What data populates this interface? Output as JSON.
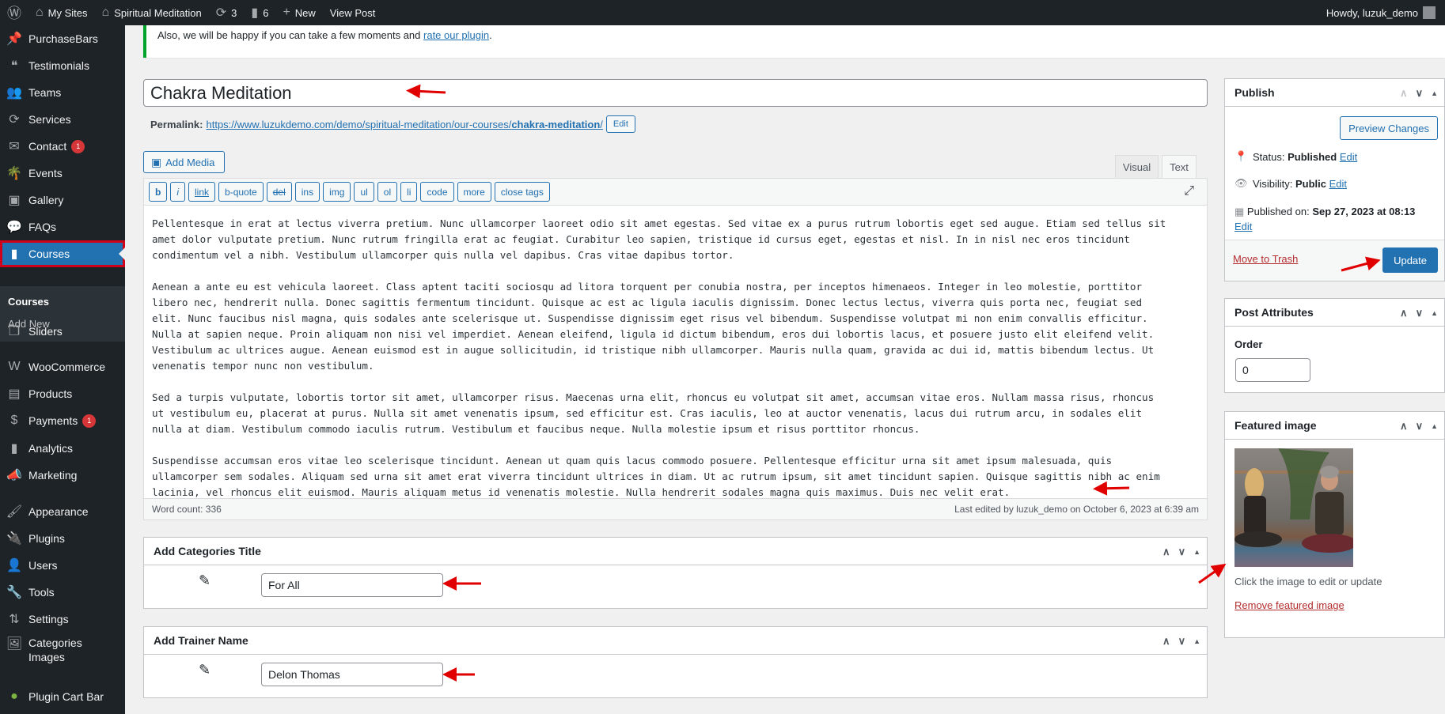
{
  "topbar": {
    "items": [
      {
        "icon": "wordpress-logo-icon",
        "label": ""
      },
      {
        "icon": "my-sites-icon",
        "label": "My Sites"
      },
      {
        "icon": "home-icon",
        "label": "Spiritual Meditation"
      },
      {
        "icon": "updates-icon",
        "label": "3"
      },
      {
        "icon": "comments-icon",
        "label": "6"
      },
      {
        "icon": "plus-icon",
        "label": "New"
      },
      {
        "icon": "",
        "label": "View Post"
      }
    ],
    "howdy": "Howdy, luzuk_demo"
  },
  "sidebar": {
    "items": [
      {
        "label": "PurchaseBars",
        "icon": "pin-icon",
        "glyph": "📌"
      },
      {
        "label": "Testimonials",
        "icon": "testimonial-icon",
        "glyph": "❝"
      },
      {
        "label": "Teams",
        "icon": "groups-icon",
        "glyph": "👥"
      },
      {
        "label": "Services",
        "icon": "update-icon",
        "glyph": "⟳"
      },
      {
        "label": "Contact",
        "icon": "email-icon",
        "glyph": "✉",
        "badge": "1"
      },
      {
        "label": "Events",
        "icon": "palm-tree-icon",
        "glyph": "🌴"
      },
      {
        "label": "Gallery",
        "icon": "media-icon",
        "glyph": "▣"
      },
      {
        "label": "FAQs",
        "icon": "chat-bubble-icon",
        "glyph": "💬"
      },
      {
        "label": "Courses",
        "icon": "book-icon",
        "glyph": "▮",
        "active": true
      },
      {
        "label": "Sliders",
        "icon": "slides-icon",
        "glyph": "❐"
      },
      {
        "label": "WooCommerce",
        "icon": "woocommerce-icon",
        "glyph": "W"
      },
      {
        "label": "Products",
        "icon": "archive-icon",
        "glyph": "▤"
      },
      {
        "label": "Payments",
        "icon": "dollar-icon",
        "glyph": "$",
        "badge": "1"
      },
      {
        "label": "Analytics",
        "icon": "bar-chart-icon",
        "glyph": "▮"
      },
      {
        "label": "Marketing",
        "icon": "megaphone-icon",
        "glyph": "📣"
      },
      {
        "label": "Appearance",
        "icon": "paintbrush-icon",
        "glyph": "🖌"
      },
      {
        "label": "Plugins",
        "icon": "plug-icon",
        "glyph": "🔌"
      },
      {
        "label": "Users",
        "icon": "user-icon",
        "glyph": "👤"
      },
      {
        "label": "Tools",
        "icon": "wrench-icon",
        "glyph": "🔧"
      },
      {
        "label": "Settings",
        "icon": "settings-icon",
        "glyph": "⇅"
      },
      {
        "label": "Categories Images",
        "icon": "image-icon",
        "glyph": "🖼"
      },
      {
        "label": "Plugin Cart Bar",
        "icon": "plugin-cart-bar-icon",
        "glyph": "●"
      }
    ],
    "submenu": [
      {
        "label": "Courses",
        "current": true
      },
      {
        "label": "Add New"
      }
    ]
  },
  "notice": {
    "text": "Also, we will be happy if you can take a few moments and ",
    "link": "rate our plugin",
    "end": "."
  },
  "post": {
    "title": "Chakra Meditation",
    "permalink_label": "Permalink:",
    "permalink_base": "https://www.luzukdemo.com/demo/spiritual-meditation/our-courses/",
    "permalink_slug": "chakra-meditation",
    "permalink_end": "/",
    "permalink_edit": "Edit"
  },
  "editor": {
    "add_media": "Add Media",
    "tabs": [
      "Visual",
      "Text"
    ],
    "active_tab": "Text",
    "quicktags": [
      "b",
      "i",
      "link",
      "b-quote",
      "del",
      "ins",
      "img",
      "ul",
      "ol",
      "li",
      "code",
      "more",
      "close tags"
    ],
    "lines": [
      "Pellentesque in erat at lectus viverra pretium. Nunc ullamcorper laoreet odio sit amet egestas. Sed vitae ex a purus rutrum lobortis eget sed augue. Etiam sed tellus sit",
      "amet dolor vulputate pretium. Nunc rutrum fringilla erat ac feugiat. Curabitur leo sapien, tristique id cursus eget, egestas et nisl. In in nisl nec eros tincidunt",
      "condimentum vel a nibh. Vestibulum ullamcorper quis nulla vel dapibus. Cras vitae dapibus tortor.",
      "",
      "Aenean a ante eu est vehicula laoreet. Class aptent taciti sociosqu ad litora torquent per conubia nostra, per inceptos himenaeos. Integer in leo molestie, porttitor",
      "libero nec, hendrerit nulla. Donec sagittis fermentum tincidunt. Quisque ac est ac ligula iaculis dignissim. Donec lectus lectus, viverra quis porta nec, feugiat sed",
      "elit. Nunc faucibus nisl magna, quis sodales ante scelerisque ut. Suspendisse dignissim eget risus vel bibendum. Suspendisse volutpat mi non enim convallis efficitur.",
      "Nulla at sapien neque. Proin aliquam non nisi vel imperdiet. Aenean eleifend, ligula id dictum bibendum, eros dui lobortis lacus, et posuere justo elit eleifend velit.",
      "Vestibulum ac ultrices augue. Aenean euismod est in augue sollicitudin, id tristique nibh ullamcorper. Mauris nulla quam, gravida ac dui id, mattis bibendum lectus. Ut",
      "venenatis tempor nunc non vestibulum.",
      "",
      "Sed a turpis vulputate, lobortis tortor sit amet, ullamcorper risus. Maecenas urna elit, rhoncus eu volutpat sit amet, accumsan vitae eros. Nullam massa risus, rhoncus",
      "ut vestibulum eu, placerat at purus. Nulla sit amet venenatis ipsum, sed efficitur est. Cras iaculis, leo at auctor venenatis, lacus dui rutrum arcu, in sodales elit",
      "nulla at diam. Vestibulum commodo iaculis rutrum. Vestibulum et faucibus neque. Nulla molestie ipsum et risus porttitor rhoncus.",
      "",
      "Suspendisse accumsan eros vitae leo scelerisque tincidunt. Aenean ut quam quis lacus commodo posuere. Pellentesque efficitur urna sit amet ipsum malesuada, quis",
      "ullamcorper sem sodales. Aliquam sed urna sit amet erat viverra tincidunt ultrices in diam. Ut ac rutrum ipsum, sit amet tincidunt sapien. Quisque sagittis nibh ac enim",
      "lacinia, vel rhoncus elit euismod. Mauris aliquam metus id venenatis molestie. Nulla hendrerit sodales magna quis maximus. Duis nec velit erat."
    ],
    "word_count": "Word count: 336",
    "last_edited": "Last edited by luzuk_demo on October 6, 2023 at 6:39 am"
  },
  "categories_box": {
    "title": "Add Categories Title",
    "value": "For All"
  },
  "trainer_box": {
    "title": "Add Trainer Name",
    "value": "Delon Thomas"
  },
  "publish": {
    "title": "Publish",
    "preview": "Preview Changes",
    "status_label": "Status: ",
    "status": "Published",
    "visibility_label": "Visibility: ",
    "visibility": "Public",
    "published_label": "Published on: ",
    "published": "Sep 27, 2023 at 08:13",
    "edit": "Edit",
    "trash": "Move to Trash",
    "update": "Update"
  },
  "attributes": {
    "title": "Post Attributes",
    "order_label": "Order",
    "order": "0"
  },
  "featured": {
    "title": "Featured image",
    "hint": "Click the image to edit or update",
    "remove": "Remove featured image"
  },
  "colors": {
    "accent": "#2271b1",
    "sidebar": "#1d2327",
    "annotation": "#e00000",
    "badge": "#d63638"
  }
}
